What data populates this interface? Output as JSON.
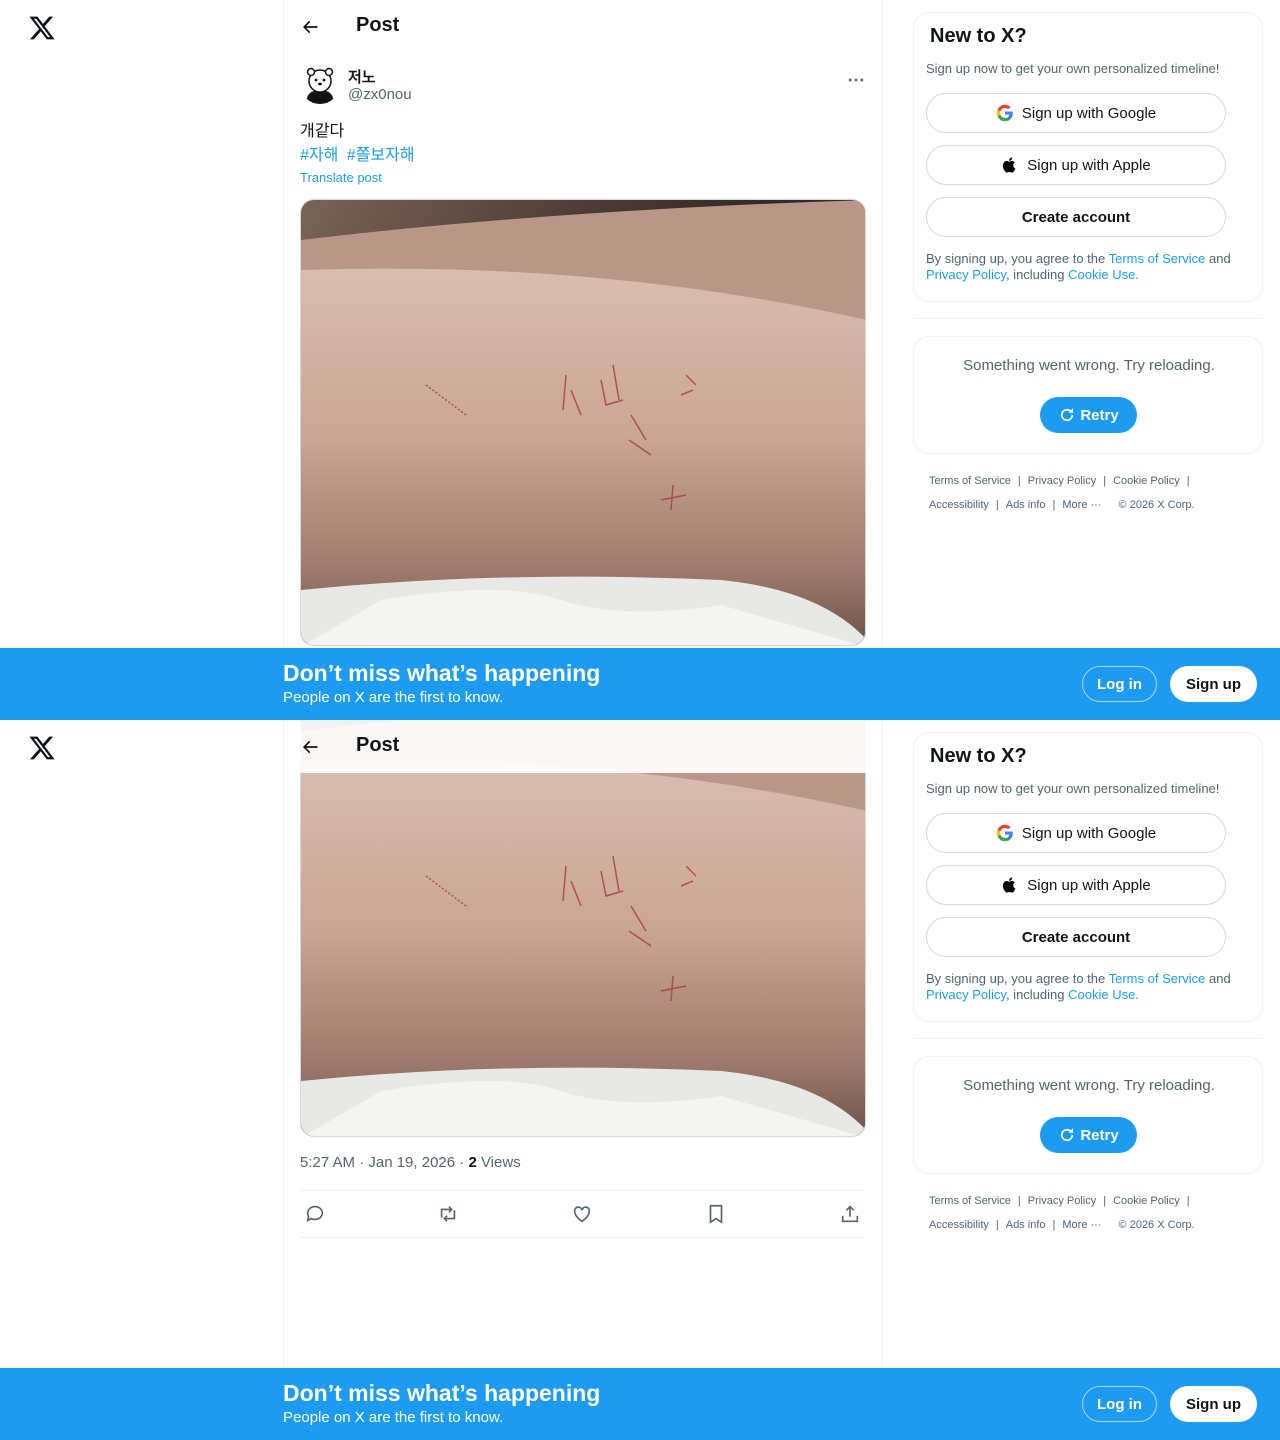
{
  "header": {
    "title": "Post"
  },
  "tweet": {
    "name": "저노",
    "handle": "@zx0nou",
    "text": "개같다",
    "hashtags": [
      "#자해",
      "#쫄보자해"
    ],
    "translate_label": "Translate post",
    "time": "5:27 AM · Jan 19, 2026 · ",
    "views_count": "2",
    "views_label": " Views"
  },
  "signup_card": {
    "title": "New to X?",
    "subtitle": "Sign up now to get your own personalized timeline!",
    "google_label": "Sign up with Google",
    "apple_label": "Sign up with Apple",
    "create_label": "Create account",
    "legal_prefix": "By signing up, you agree to the ",
    "terms_link": "Terms of Service",
    "legal_and": " and ",
    "privacy_link": "Privacy Policy",
    "legal_including": ", including ",
    "cookie_link": "Cookie Use."
  },
  "error_card": {
    "message": "Something went wrong. Try reloading.",
    "retry_label": "Retry"
  },
  "footer": {
    "terms": "Terms of Service",
    "privacy": "Privacy Policy",
    "cookie": "Cookie Policy",
    "accessibility": "Accessibility",
    "ads": "Ads info",
    "more": "More ···",
    "copyright": "© 2026 X Corp."
  },
  "banner": {
    "headline": "Don’t miss what’s happening",
    "subline": "People on X are the first to know.",
    "login_label": "Log in",
    "signup_label": "Sign up"
  },
  "colors": {
    "accent": "#1d9bf0",
    "text": "#0f1419",
    "muted": "#536471",
    "border": "#eff3f4"
  }
}
